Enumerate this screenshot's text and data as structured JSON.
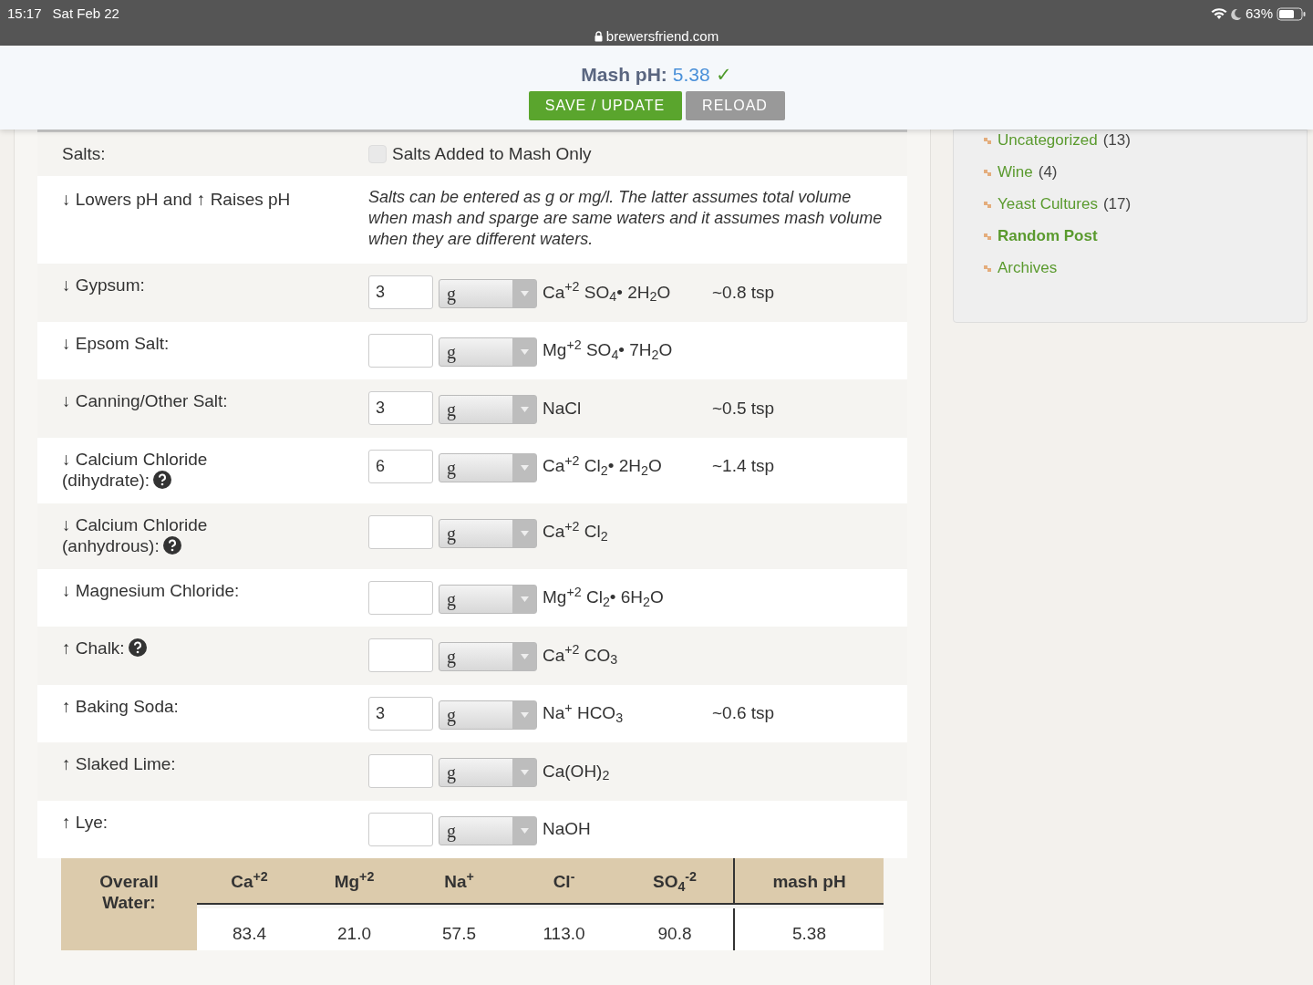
{
  "status_bar": {
    "time": "15:17",
    "date": "Sat Feb 22",
    "url": "brewersfriend.com",
    "battery": "63%"
  },
  "header": {
    "label": "Mash pH:",
    "value": "5.38",
    "check": "✓",
    "buttons": [
      {
        "label": "SAVE / UPDATE",
        "kind": "primary"
      },
      {
        "label": "RELOAD",
        "kind": "secondary"
      }
    ]
  },
  "salts_header": {
    "label": "Salts:",
    "checkbox": {
      "label": "Salts Added to Mash Only",
      "checked": false
    }
  },
  "legend": {
    "label": "↓ Lowers pH and ↑ Raises pH",
    "note": "Salts can be entered as g or mg/l. The latter assumes total volume when mash and sparge are same waters and it assumes mash volume when they are different waters."
  },
  "salts": [
    {
      "name": "↓ Gypsum:",
      "help": false,
      "value": "3",
      "unit": "g",
      "formula": "Ca$^{+2}$ SO$_{4}$• 2H$_{2}$O",
      "tsp": "~0.8 tsp"
    },
    {
      "name": "↓ Epsom Salt:",
      "help": false,
      "unit": "g",
      "formula": "Mg$^{+2}$ SO$_{4}$• 7H$_{2}$O"
    },
    {
      "name": "↓ Canning/Other Salt:",
      "help": false,
      "value": "3",
      "unit": "g",
      "formula": "NaCl",
      "tsp": "~0.5 tsp"
    },
    {
      "name": "↓ Calcium Chloride (dihydrate):",
      "help": true,
      "value": "6",
      "unit": "g",
      "formula": "Ca$^{+2}$ Cl$_{2}$• 2H$_{2}$O",
      "tsp": "~1.4 tsp"
    },
    {
      "name": "↓ Calcium Chloride (anhydrous):",
      "help": true,
      "unit": "g",
      "formula": "Ca$^{+2}$ Cl$_{2}$"
    },
    {
      "name": "↓ Magnesium Chloride:",
      "help": false,
      "unit": "g",
      "formula": "Mg$^{+2}$ Cl$_{2}$• 6H$_{2}$O"
    },
    {
      "name": "↑ Chalk:",
      "help": true,
      "unit": "g",
      "formula": "Ca$^{+2}$ CO$_{3}$"
    },
    {
      "name": "↑ Baking Soda:",
      "help": false,
      "value": "3",
      "unit": "g",
      "formula": "Na$^{+}$ HCO$_{3}$",
      "tsp": "~0.6 tsp"
    },
    {
      "name": "↑ Slaked Lime:",
      "help": false,
      "unit": "g",
      "formula": "Ca(OH)$_{2}$"
    },
    {
      "name": "↑ Lye:",
      "help": false,
      "unit": "g",
      "formula": "NaOH"
    }
  ],
  "overall": {
    "label": "Overall Water:",
    "columns": [
      "Ca$^{+2}$",
      "Mg$^{+2}$",
      "Na$^{+}$",
      "Cl$^{-}$",
      "SO$_{4}$$^{-2}$",
      "mash pH"
    ],
    "values": [
      "83.4",
      "21.0",
      "57.5",
      "113.0",
      "90.8",
      "5.38"
    ]
  },
  "sidebar": {
    "items": [
      {
        "label": "Uncategorized",
        "count": "(13)",
        "bold": false
      },
      {
        "label": "Wine",
        "count": "(4)",
        "bold": false
      },
      {
        "label": "Yeast Cultures",
        "count": "(17)",
        "bold": false
      },
      {
        "label": "Random Post",
        "bold": true
      },
      {
        "label": "Archives",
        "bold": false
      }
    ]
  }
}
